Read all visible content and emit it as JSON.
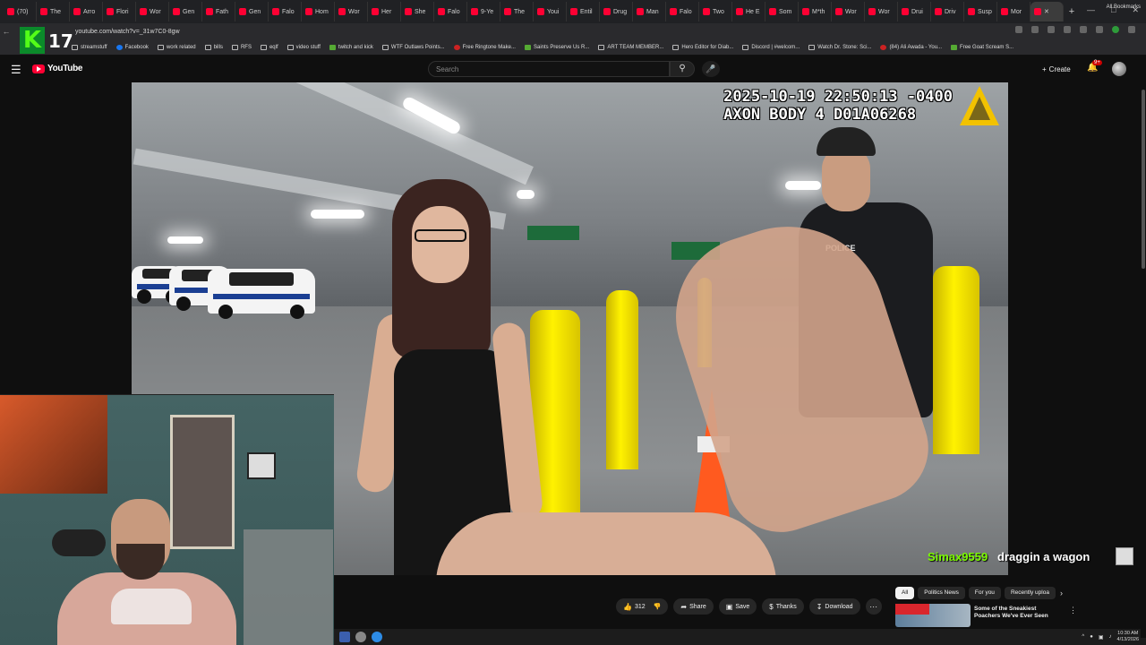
{
  "browser": {
    "tabs": [
      "(70)",
      "The",
      "Arro",
      "Flori",
      "Wor",
      "Gen",
      "Fath",
      "Gen",
      "Falo",
      "Hom",
      "Wor",
      "Her",
      "She",
      "Falo",
      "9-Ye",
      "The",
      "Youi",
      "Entil",
      "Drug",
      "Man",
      "Falo",
      "Two",
      "He E",
      "Som",
      "M*th",
      "Wor",
      "Wor",
      "Drui",
      "Driv",
      "Susp",
      "Mor"
    ],
    "active_tab_index": 31,
    "url": "youtube.com/watch?v=_31w7C0-8gw",
    "bookmarks": [
      "streamstuff",
      "Facebook",
      "work related",
      "bills",
      "RFS",
      "eqlf",
      "video stuff",
      "twitch and kick",
      "WTF Outlaws Points...",
      "Free Ringtone Make...",
      "Saints Preserve Us R...",
      "ART TEAM MEMBER...",
      "Hero Editor for Diab...",
      "Discord | #welcom...",
      "Watch Dr. Stone: Sci...",
      "(84) Ali Awada - You...",
      "Free Goat Scream S..."
    ],
    "all_bookmarks": "All Bookmarks"
  },
  "overlay": {
    "kick_logo": "K",
    "kick_count": "17",
    "bodycam_timestamp": "2025-10-19 22:50:13 -0400",
    "bodycam_device": "AXON BODY 4 D01A06268",
    "police_label": "POLICE"
  },
  "youtube": {
    "logo_text": "YouTube",
    "search_placeholder": "Search",
    "create_label": "Create",
    "notification_count": "9+",
    "like_count": "312",
    "share_label": "Share",
    "save_label": "Save",
    "thanks_label": "Thanks",
    "download_label": "Download",
    "chips": [
      "All",
      "Politics News",
      "For you",
      "Recently uploa"
    ],
    "recommended": [
      {
        "title": "Some of the Sneakiest Poachers We've Ever Seen"
      }
    ]
  },
  "chat": {
    "username": "Simax9559",
    "message": "draggin a wagon"
  },
  "taskbar": {
    "time": "10:30 AM",
    "date": "4/13/2026"
  }
}
